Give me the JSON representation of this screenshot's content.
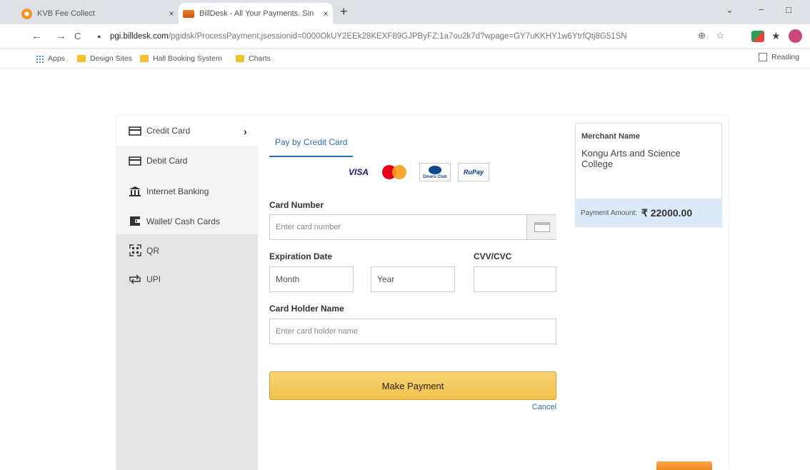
{
  "browser": {
    "tabs": [
      {
        "title": "KVB Fee Collect",
        "close": "×"
      },
      {
        "title": "BillDesk - All Your Payments. Sin",
        "close": "×"
      }
    ],
    "new_tab": "+",
    "window_controls": [
      "⌄",
      "−",
      "□"
    ],
    "nav": {
      "back": "←",
      "forward": "→",
      "reload": "C"
    },
    "url_host": "pgi.billdesk.com",
    "url_path": "/pgidsk/ProcessPayment;jsessionid=0000OkUY2EEk28KEXF89GJPByFZ:1a7ou2k7d?wpage=GY7uKKHY1w6YtrfQtj8G51SN",
    "bookmarks": [
      "Apps",
      "Design Sites",
      "Hall Booking System",
      "Charts"
    ],
    "reading_list": "Reading"
  },
  "payment": {
    "methods": [
      {
        "label": "Credit Card",
        "icon": "credit-card-icon"
      },
      {
        "label": "Debit Card",
        "icon": "debit-card-icon"
      },
      {
        "label": "Internet Banking",
        "icon": "bank-icon"
      },
      {
        "label": "Wallet/ Cash Cards",
        "icon": "wallet-icon"
      },
      {
        "label": "QR",
        "icon": "qr-icon"
      },
      {
        "label": "UPI",
        "icon": "upi-icon"
      }
    ],
    "active_chevron": "›",
    "tab_label": "Pay by Credit Card",
    "card_logos": {
      "visa": "VISA",
      "diners": "Diners Club",
      "rupay": "RuPay"
    },
    "card_number_label": "Card Number",
    "card_number_placeholder": "Enter card number",
    "expiry_label": "Expiration Date",
    "month_value": "Month",
    "year_value": "Year",
    "cvv_label": "CVV/CVC",
    "holder_label": "Card Holder Name",
    "holder_placeholder": "Enter card holder name",
    "submit": "Make Payment",
    "cancel": "Cancel"
  },
  "merchant": {
    "name_label": "Merchant Name",
    "name": "Kongu Arts and Science College",
    "amount_label": "Payment Amount:",
    "amount": "₹ 22000.00"
  }
}
